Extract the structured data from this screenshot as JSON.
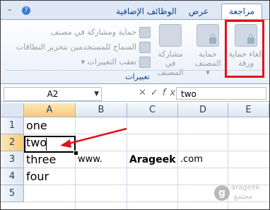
{
  "tabs": {
    "items": [
      {
        "label": "مراجعة",
        "active": true
      },
      {
        "label": "عرض",
        "active": false
      },
      {
        "label": "الوظائف الإضافية",
        "active": false
      }
    ],
    "help": "?",
    "minimize": "–"
  },
  "ribbon": {
    "group_label": "تغييرات",
    "commands": {
      "unprotect_sheet": "إلغاء حماية ورقة",
      "protect_workbook_line1": "حماية",
      "protect_workbook_line2": "المصنف ▾",
      "share_workbook_line1": "مشاركة في",
      "share_workbook_line2": "المصنف",
      "protect_and_share": "حماية ومشاركة في مصنف",
      "allow_users_edit": "السماح للمستخدمين بتحرير النطاقات",
      "track_changes": "تعقب التغييرات ▾"
    }
  },
  "formula_bar": {
    "name_box": "A2",
    "cancel": "✕",
    "enter": "✓",
    "fx": "fx",
    "value": "two"
  },
  "grid": {
    "columns": [
      "A",
      "B",
      "C",
      "D",
      "E"
    ],
    "rows": [
      "1",
      "2",
      "3",
      "4",
      "5"
    ],
    "cells": {
      "A1": "one",
      "A2": "two",
      "A3": "three",
      "B3": "www.",
      "C3": "Arageek",
      "D3": ".com",
      "A4": "four"
    },
    "active_cell": "A2"
  },
  "watermark": {
    "logo": "g",
    "line1": "arageek",
    "line2": "مجتمع"
  },
  "colors": {
    "highlight": "#e0151b",
    "arrow": "#e0151b",
    "ribbon_text": "#15428b"
  }
}
